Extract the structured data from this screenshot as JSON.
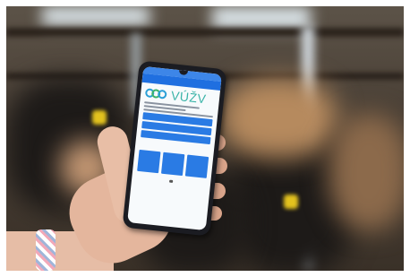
{
  "photo": {
    "description_subject": "",
    "app": {
      "brand": "VÚŽV",
      "screen_buttons": [
        "",
        "",
        ""
      ]
    },
    "colors": {
      "app_primary": "#2a7be4",
      "logo_teal": "#39b3a7",
      "logo_green": "#3bb36a",
      "logo_blue": "#2a9fd6",
      "skin": "#e4b69d",
      "background": "#4a4036"
    },
    "icons": [
      "phone-icon",
      "bracelet"
    ]
  }
}
